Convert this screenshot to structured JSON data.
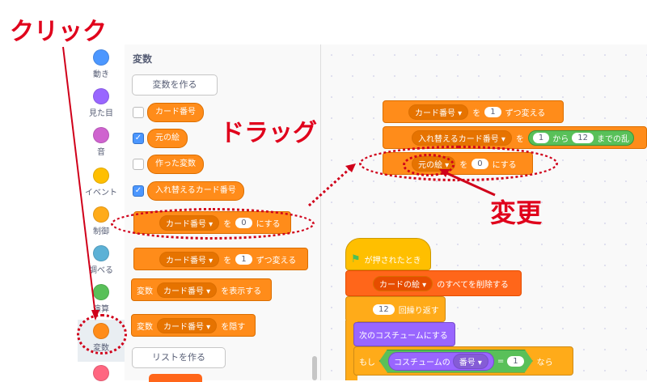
{
  "categories": [
    {
      "label": "動き",
      "color": "#4c97ff"
    },
    {
      "label": "見た目",
      "color": "#9966ff"
    },
    {
      "label": "音",
      "color": "#cf63cf"
    },
    {
      "label": "イベント",
      "color": "#ffbf00"
    },
    {
      "label": "制御",
      "color": "#ffab19"
    },
    {
      "label": "調べる",
      "color": "#5cb1d6"
    },
    {
      "label": "演算",
      "color": "#59c059"
    },
    {
      "label": "変数",
      "color": "#ff8c1a"
    },
    {
      "label": "",
      "color": "#ff6680"
    }
  ],
  "palette": {
    "title": "変数",
    "make_variable": "変数を作る",
    "variables": [
      {
        "name": "カード番号",
        "checked": false
      },
      {
        "name": "元の絵",
        "checked": true
      },
      {
        "name": "作った変数",
        "checked": false
      },
      {
        "name": "入れ替えるカード番号",
        "checked": true
      }
    ],
    "set_block": {
      "var": "カード番号",
      "to": "を",
      "value": "0",
      "suffix": "にする"
    },
    "change_block": {
      "var": "カード番号",
      "by": "を",
      "value": "1",
      "suffix": "ずつ変える"
    },
    "show_block": {
      "prefix": "変数",
      "var": "カード番号",
      "suffix": "を表示する"
    },
    "hide_block": {
      "prefix": "変数",
      "var": "カード番号",
      "suffix": "を隠す"
    },
    "make_list": "リストを作る"
  },
  "workspace": {
    "stack1": {
      "change": {
        "var": "カード番号",
        "by": "を",
        "value": "1",
        "suffix": "ずつ変える"
      },
      "set_random": {
        "var": "入れ替えるカード番号",
        "to": "を",
        "from": "1",
        "from_label": "から",
        "to_value": "12",
        "suffix": "までの乱"
      },
      "set_orig": {
        "var": "元の絵",
        "to": "を",
        "value": "0",
        "suffix": "にする"
      }
    },
    "stack2": {
      "hat": "が押されたとき",
      "delete": {
        "var": "カードの絵",
        "suffix": "のすべてを削除する"
      },
      "repeat": {
        "value": "12",
        "suffix": "回繰り返す"
      },
      "next_costume": "次のコスチュームにする",
      "if": {
        "prefix": "もし",
        "reporter": "コスチュームの",
        "dd": "番号",
        "eq": "=",
        "value": "1",
        "suffix": "なら"
      }
    }
  },
  "annotations": {
    "click": "クリック",
    "drag": "ドラッグ",
    "change": "変更"
  }
}
